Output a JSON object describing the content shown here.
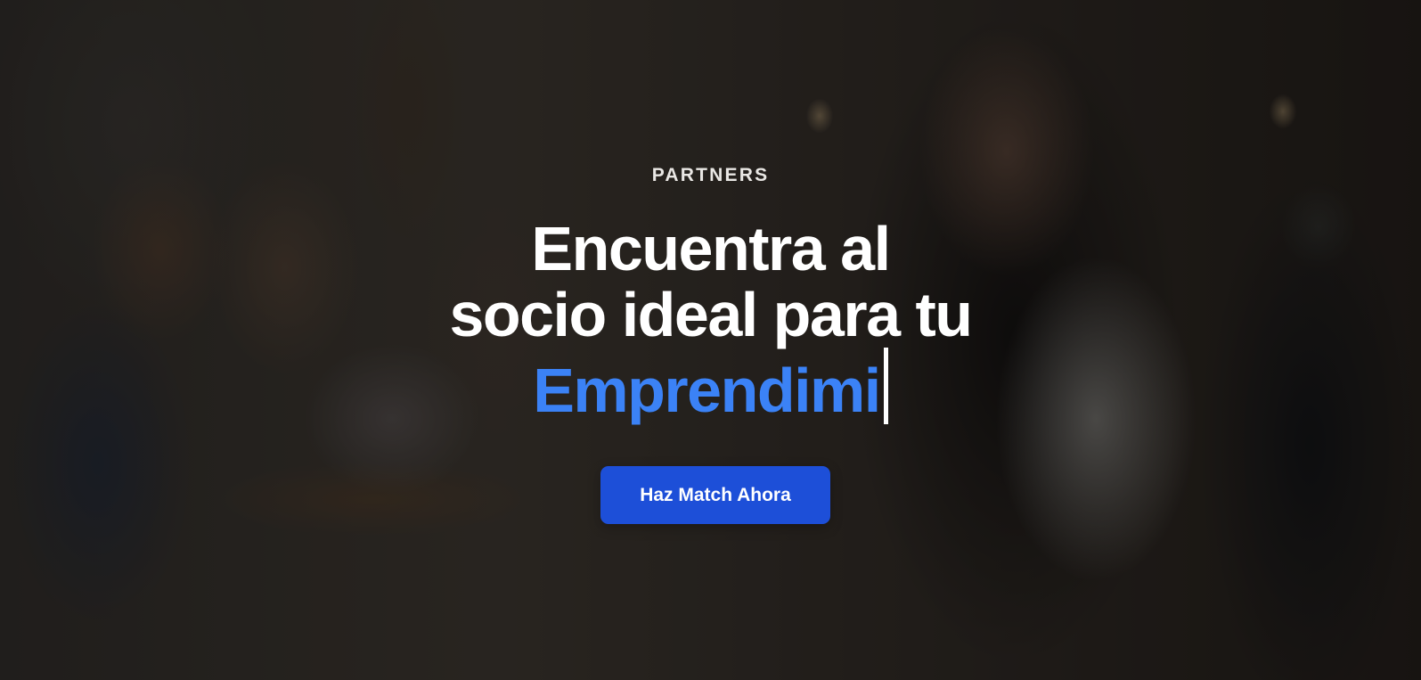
{
  "hero": {
    "eyebrow": "PARTNERS",
    "headline_line1": "Encuentra al",
    "headline_line2": "socio ideal para tu",
    "typed_word": "Emprendimi",
    "cta_label": "Haz Match Ahora"
  },
  "colors": {
    "accent_blue_text": "#3b82f6",
    "button_blue": "#1d4fd8",
    "text_white": "#ffffff"
  }
}
